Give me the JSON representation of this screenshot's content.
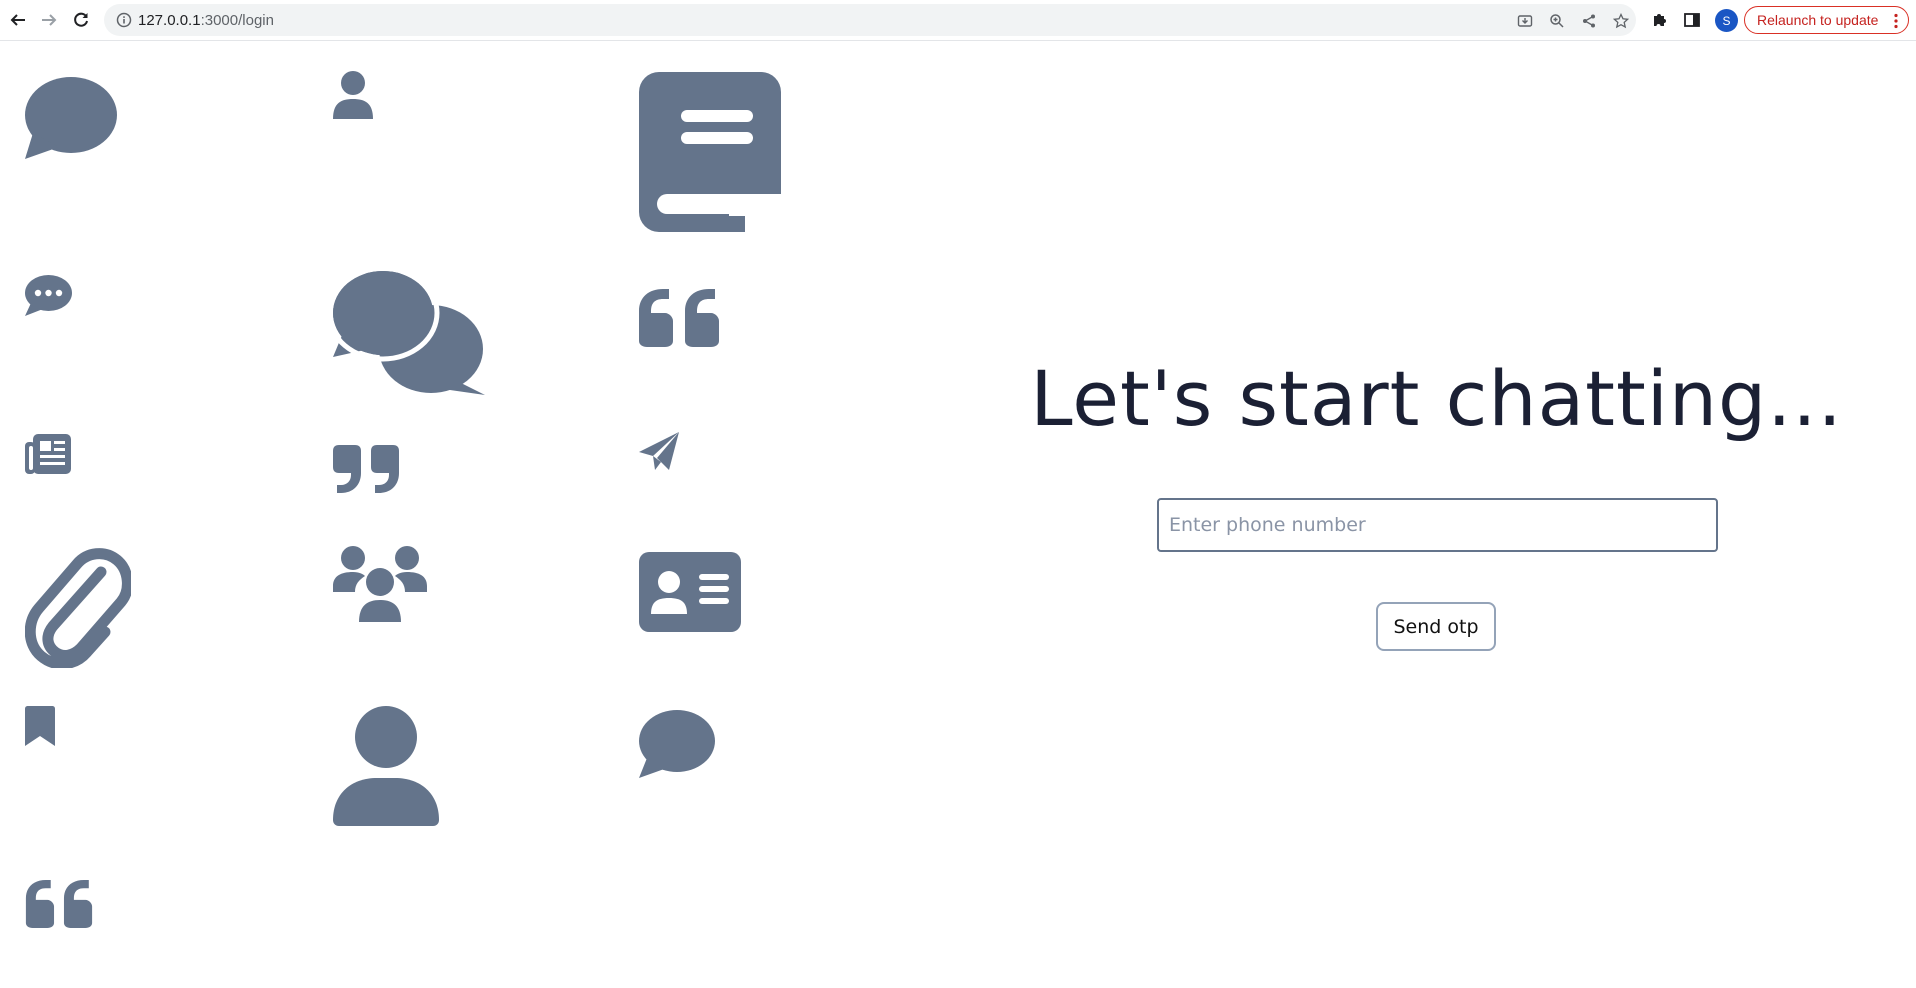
{
  "browser": {
    "url_host": "127.0.0.1",
    "url_path": ":3000/login",
    "profile_initial": "S",
    "relaunch_label": "Relaunch to update"
  },
  "colors": {
    "icon": "#64748b",
    "heading": "#1b2034",
    "relaunch": "#d93025"
  },
  "decor_icons": [
    "comment-icon",
    "user-icon",
    "book-icon",
    "comment-dots-icon",
    "comments-icon",
    "quote-left-icon",
    "newspaper-icon",
    "quote-right-icon",
    "paper-plane-icon",
    "paperclip-icon",
    "users-icon",
    "id-card-icon",
    "bookmark-icon",
    "user-large-icon",
    "comment-small-icon",
    "quote-left-large-icon"
  ],
  "login": {
    "heading": "Let's start chatting...",
    "phone_placeholder": "Enter phone number",
    "phone_value": "",
    "send_label": "Send otp"
  }
}
